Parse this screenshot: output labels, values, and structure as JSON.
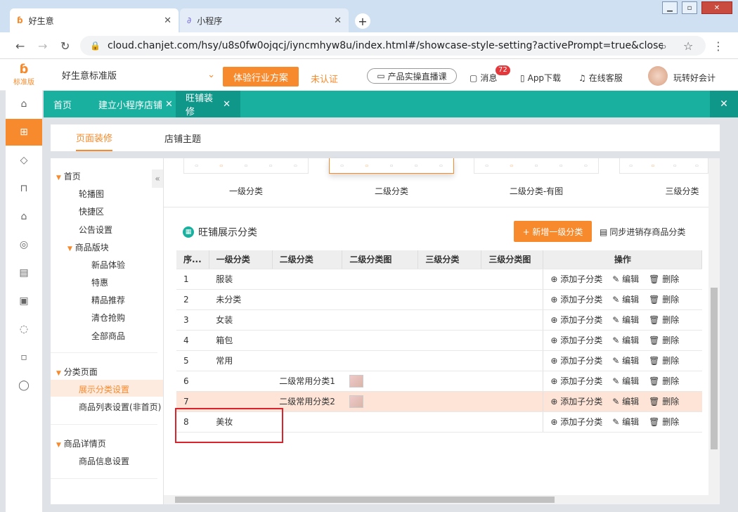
{
  "browser": {
    "tabs": [
      {
        "label": "好生意"
      },
      {
        "label": "小程序"
      }
    ],
    "url": "cloud.chanjet.com/hsy/u8s0fw0ojqcj/iyncmhyw8u/index.html#/showcase-style-setting?activePrompt=true&close..."
  },
  "app": {
    "logo_text": "标准版",
    "edition": "好生意标准版",
    "cta": "体验行业方案",
    "auth": "未认证",
    "live": "产品实操直播课",
    "msg_label": "消息",
    "msg_count": "72",
    "app_download": "App下载",
    "service": "在线客服",
    "user": "玩转好会计"
  },
  "nav": {
    "home": "首页",
    "tab1": "建立小程序店铺",
    "tab2": "旺铺装修"
  },
  "subtabs": {
    "t1": "页面装修",
    "t2": "店铺主题"
  },
  "tree": {
    "home": "首页",
    "lunbo": "轮播图",
    "kuaijie": "快捷区",
    "gonggao": "公告设置",
    "goods": "商品版块",
    "g1": "新品体验",
    "g2": "特惠",
    "g3": "精品推荐",
    "g4": "清仓抢购",
    "g5": "全部商品",
    "cat": "分类页面",
    "cat1": "展示分类设置",
    "cat2": "商品列表设置(非首页)",
    "detail": "商品详情页",
    "detail1": "商品信息设置"
  },
  "styles": {
    "s1": "一级分类",
    "s2": "二级分类",
    "s3": "二级分类-有图",
    "s4": "三级分类"
  },
  "section": {
    "title": "旺铺展示分类",
    "add": "+ 新增一级分类",
    "sync": "同步进销存商品分类"
  },
  "table": {
    "headers": [
      "序...",
      "一级分类",
      "二级分类",
      "二级分类图",
      "三级分类",
      "三级分类图",
      "操作"
    ],
    "ops": {
      "add": "添加子分类",
      "edit": "编辑",
      "del": "删除"
    },
    "rows": [
      {
        "no": "1",
        "c1": "服装",
        "c2": ""
      },
      {
        "no": "2",
        "c1": "未分类",
        "c2": ""
      },
      {
        "no": "3",
        "c1": "女装",
        "c2": ""
      },
      {
        "no": "4",
        "c1": "箱包",
        "c2": ""
      },
      {
        "no": "5",
        "c1": "常用",
        "c2": ""
      },
      {
        "no": "6",
        "c1": "",
        "c2": "二级常用分类1"
      },
      {
        "no": "7",
        "c1": "",
        "c2": "二级常用分类2"
      },
      {
        "no": "8",
        "c1": "美妆",
        "c2": ""
      }
    ]
  },
  "colors": {
    "orange": "#f78a2c",
    "teal": "#19b0a0",
    "highlight": "#fde4d6",
    "annotation": "#d9232d"
  }
}
